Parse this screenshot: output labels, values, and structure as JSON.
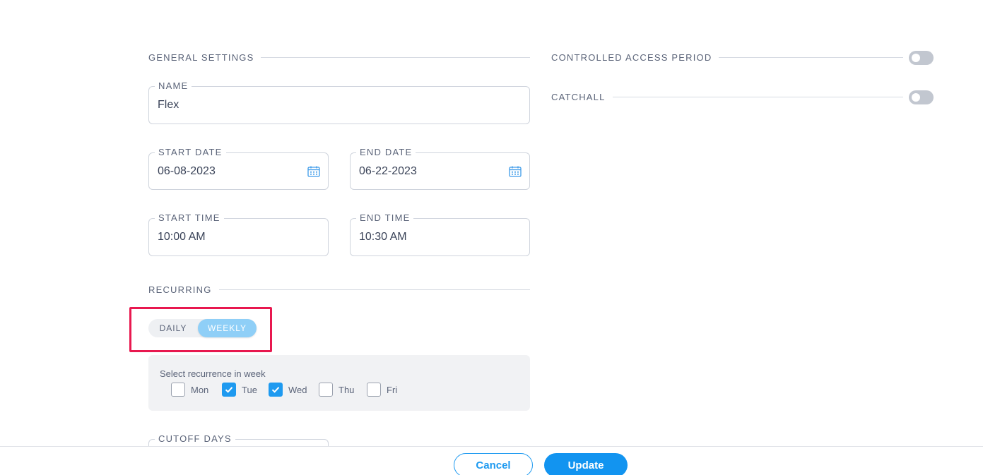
{
  "general_settings": {
    "title": "GENERAL SETTINGS",
    "name": {
      "label": "NAME",
      "value": "Flex"
    },
    "start_date": {
      "label": "START DATE",
      "value": "06-08-2023"
    },
    "end_date": {
      "label": "END DATE",
      "value": "06-22-2023"
    },
    "start_time": {
      "label": "START TIME",
      "value": "10:00 AM"
    },
    "end_time": {
      "label": "END TIME",
      "value": "10:30 AM"
    }
  },
  "controlled_access": {
    "label": "CONTROLLED ACCESS PERIOD",
    "enabled": false
  },
  "catchall": {
    "label": "CATCHALL",
    "enabled": false
  },
  "recurring": {
    "title": "RECURRING",
    "options": [
      "DAILY",
      "WEEKLY"
    ],
    "selected": "WEEKLY",
    "panel_title": "Select recurrence in week",
    "days": [
      {
        "label": "Mon",
        "checked": false
      },
      {
        "label": "Tue",
        "checked": true
      },
      {
        "label": "Wed",
        "checked": true
      },
      {
        "label": "Thu",
        "checked": false
      },
      {
        "label": "Fri",
        "checked": false
      }
    ]
  },
  "cutoff_days": {
    "label": "CUTOFF DAYS"
  },
  "footer": {
    "cancel_label": "Cancel",
    "update_label": "Update"
  },
  "colors": {
    "accent": "#1e9af0",
    "segment_selected": "#8fcff7",
    "highlight": "#e8184f",
    "toggle_off": "#c2c7d0"
  },
  "icons": {
    "calendar": "calendar-icon",
    "check": "check-icon"
  }
}
